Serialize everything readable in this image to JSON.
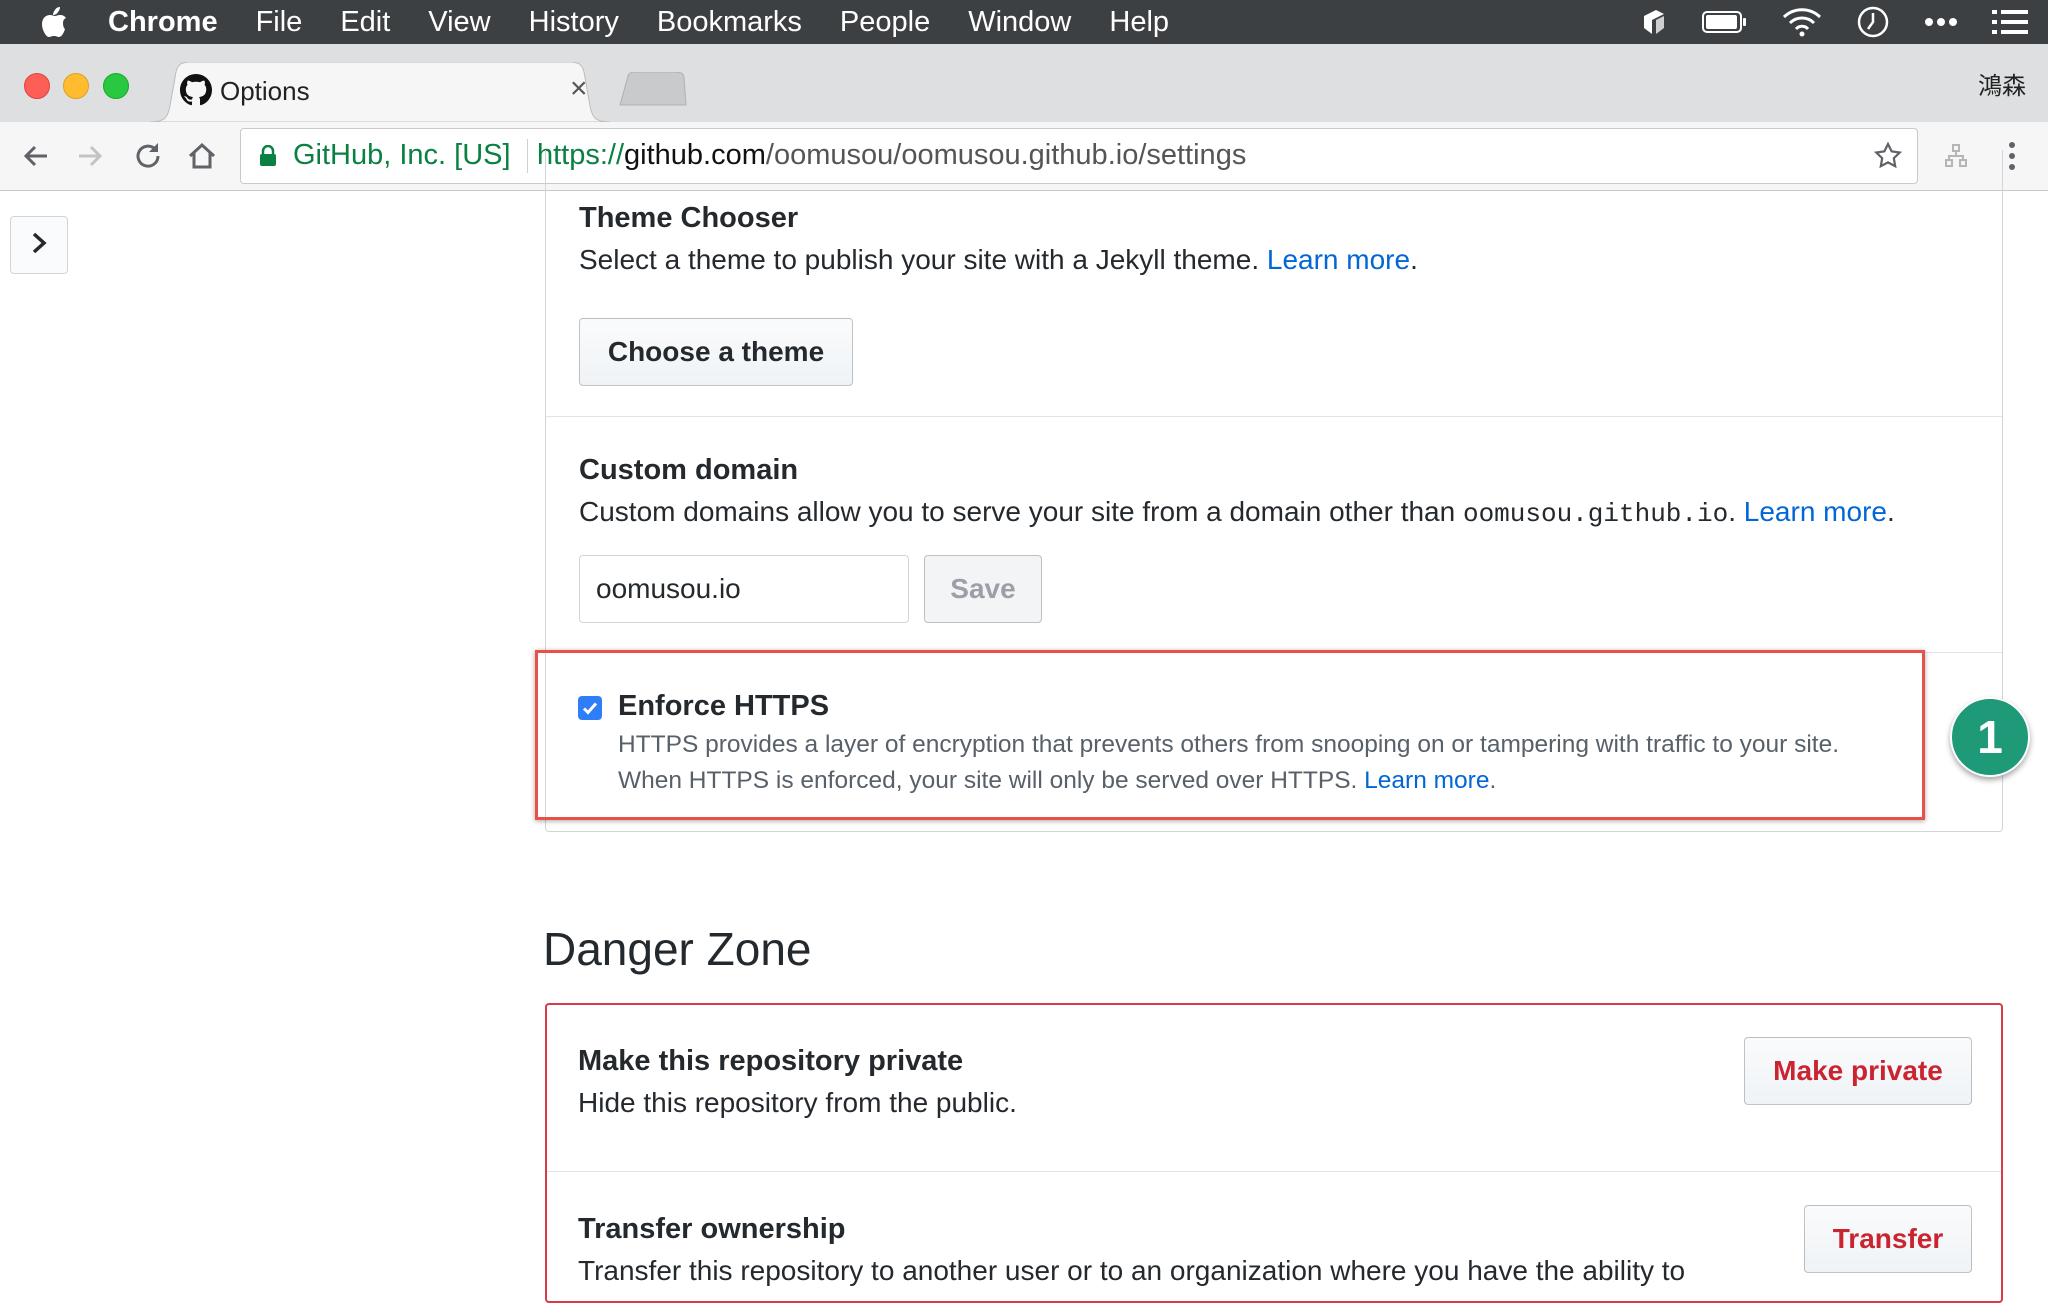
{
  "menubar": {
    "app_name": "Chrome",
    "items": [
      "File",
      "Edit",
      "View",
      "History",
      "Bookmarks",
      "People",
      "Window",
      "Help"
    ]
  },
  "tab": {
    "title": "Options",
    "close_glyph": "×",
    "favicon": "github-icon"
  },
  "profile_name": "鴻森",
  "omnibox": {
    "secure_label": "GitHub, Inc. [US]",
    "url_scheme": "https://",
    "url_host": "github.com",
    "url_path": "/oomusou/oomusou.github.io/settings"
  },
  "theme": {
    "title": "Theme Chooser",
    "desc": "Select a theme to publish your site with a Jekyll theme. ",
    "learn_more": "Learn more",
    "period": ".",
    "button": "Choose a theme"
  },
  "custom_domain": {
    "title": "Custom domain",
    "desc_pre": "Custom domains allow you to serve your site from a domain other than ",
    "desc_code": "oomusou.github.io",
    "desc_mid": ". ",
    "learn_more": "Learn more",
    "period": ".",
    "input_value": "oomusou.io",
    "save_button": "Save"
  },
  "https": {
    "checked": true,
    "title": "Enforce HTTPS",
    "line1": "HTTPS provides a layer of encryption that prevents others from snooping on or tampering with traffic to your site.",
    "line2": "When HTTPS is enforced, your site will only be served over HTTPS. ",
    "learn_more": "Learn more",
    "period": "."
  },
  "annotation_badge": "1",
  "danger_zone": {
    "heading": "Danger Zone",
    "private": {
      "title": "Make this repository private",
      "desc": "Hide this repository from the public.",
      "button": "Make private"
    },
    "transfer": {
      "title": "Transfer ownership",
      "desc": "Transfer this repository to another user or to an organization where you have the ability to",
      "button": "Transfer"
    }
  },
  "colors": {
    "link": "#0366d6",
    "danger": "#cb2431",
    "highlight": "#e8514a",
    "badge": "#1f9a78",
    "secure": "#0b8043"
  }
}
